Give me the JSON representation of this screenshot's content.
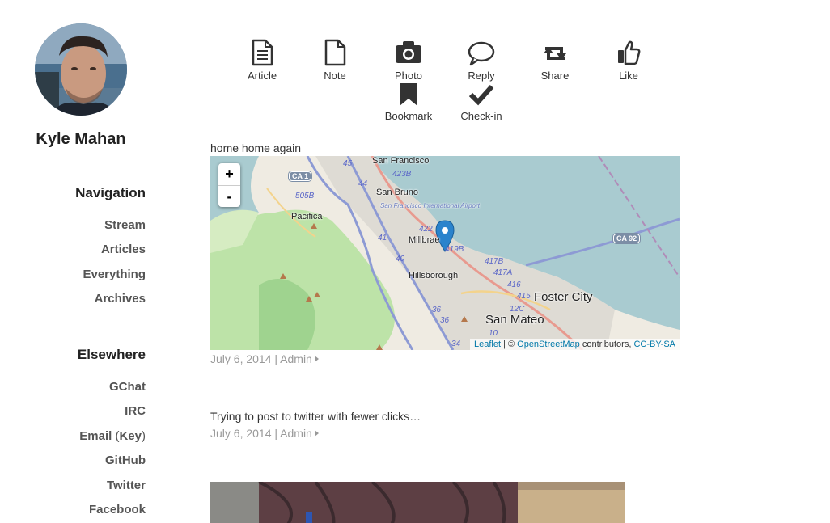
{
  "sidebar": {
    "author_name": "Kyle Mahan",
    "navigation_heading": "Navigation",
    "navigation": [
      "Stream",
      "Articles",
      "Everything",
      "Archives"
    ],
    "elsewhere_heading": "Elsewhere",
    "elsewhere": {
      "gchat": "GChat",
      "irc": "IRC",
      "email": "Email",
      "email_key_open": " (",
      "email_key": "Key",
      "email_key_close": ")",
      "github": "GitHub",
      "twitter": "Twitter",
      "facebook": "Facebook"
    }
  },
  "post_types": [
    "Article",
    "Note",
    "Photo",
    "Reply",
    "Share",
    "Like",
    "Bookmark",
    "Check-in"
  ],
  "posts": [
    {
      "text": "home home again",
      "date": "July 6, 2014",
      "separator": "|",
      "author": "Admin",
      "map": {
        "zoom_in": "+",
        "zoom_out": "-",
        "attribution": {
          "leaflet": "Leaflet",
          "sep": " | © ",
          "osm": "OpenStreetMap",
          "contributors": " contributors, ",
          "license": "CC-BY-SA"
        },
        "labels": {
          "san_francisco": "San Francisco",
          "san_bruno": "San Bruno",
          "sfo": "San Francisco International Airport",
          "pacifica": "Pacifica",
          "millbrae": "Millbrae",
          "hillsborough": "Hillsborough",
          "foster_city": "Foster City",
          "san_mateo": "San Mateo"
        },
        "shields": {
          "ca1": "CA 1",
          "ca92": "CA 92"
        },
        "highways": {
          "h45": "45",
          "h44": "44",
          "h505b": "505B",
          "h423b": "423B",
          "h41": "41",
          "h422": "422",
          "h419b": "419B",
          "h40": "40",
          "h417b": "417B",
          "h417a": "417A",
          "h416": "416",
          "h415": "415",
          "h12c": "12C",
          "h36a": "36",
          "h36b": "36",
          "h10": "10",
          "h34": "34"
        }
      }
    },
    {
      "text": "Trying to post to twitter with fewer clicks…",
      "date": "July 6, 2014",
      "separator": "|",
      "author": "Admin"
    }
  ]
}
